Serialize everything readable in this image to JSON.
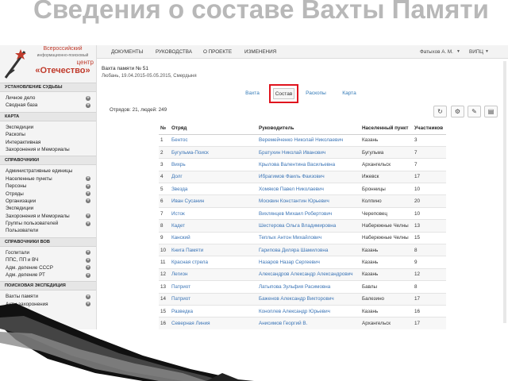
{
  "slide_title": "Сведения о составе Вахты Памяти",
  "logo": {
    "line1": "Всероссийский",
    "line2": "информационно-поисковый",
    "line3": "центр",
    "line4": "«Отечество»"
  },
  "sidebar": {
    "sections": [
      {
        "title": "УСТАНОВЛЕНИЕ СУДЬБЫ",
        "items": [
          {
            "label": "Личное дело",
            "plus": true
          },
          {
            "label": "Сводная база",
            "plus": true
          }
        ]
      },
      {
        "title": "КАРТА",
        "items": [
          {
            "label": "Экспедиции",
            "plus": false
          },
          {
            "label": "Раскопы",
            "plus": false
          },
          {
            "label": "Интерактивная",
            "plus": false
          },
          {
            "label": "Захоронения и Мемориалы",
            "plus": false
          }
        ]
      },
      {
        "title": "СПРАВОЧНИКИ",
        "items": [
          {
            "label": "Административные единицы",
            "plus": false
          },
          {
            "label": "Населенные пункты",
            "plus": true
          },
          {
            "label": "Персоны",
            "plus": true
          },
          {
            "label": "Отряды",
            "plus": true
          },
          {
            "label": "Организации",
            "plus": true
          },
          {
            "label": "Экспедиции",
            "plus": false
          },
          {
            "label": "Захоронения и Мемориалы",
            "plus": true
          },
          {
            "label": "Группы пользователей",
            "plus": true
          },
          {
            "label": "Пользователи",
            "plus": false
          }
        ]
      },
      {
        "title": "СПРАВОЧНИКИ ВОВ",
        "items": [
          {
            "label": "Госпитали",
            "plus": true
          },
          {
            "label": "ППС, ПП и ВЧ",
            "plus": true
          },
          {
            "label": "Адм. деление СССР",
            "plus": true
          },
          {
            "label": "Адм. деление РТ",
            "plus": true
          }
        ]
      },
      {
        "title": "ПОИСКОВАЯ ЭКСПЕДИЦИЯ",
        "items": [
          {
            "label": "Вахты памяти",
            "plus": true
          },
          {
            "label": "Акты захоронения",
            "plus": true
          }
        ]
      }
    ]
  },
  "topnav": {
    "items": [
      "ДОКУМЕНТЫ",
      "РУКОВОДСТВА",
      "О ПРОЕКТЕ",
      "ИЗМЕНЕНИЯ"
    ],
    "user": "Фатыхов А. М.",
    "org": "ВИПЦ"
  },
  "watch": {
    "title": "Вахта памяти № 51",
    "subtitle": "Любань, 19.04.2015-05.05.2015, Смердыня"
  },
  "tabs": [
    "Вахта",
    "Состав",
    "Раскопы",
    "Карта"
  ],
  "stats": "Отрядов: 21, людей: 249",
  "toolbar_icons": [
    "refresh-icon",
    "gear-icon",
    "edit-icon",
    "print-icon"
  ],
  "table": {
    "columns": [
      "№",
      "Отряд",
      "Руководитель",
      "Населенный пункт",
      "Участников"
    ],
    "rows": [
      [
        "1",
        "Бентос",
        "Веремейченко Николай Николаевич",
        "Казань",
        "3"
      ],
      [
        "2",
        "Бугульма-Поиск",
        "Братухин Николай Иванович",
        "Бугульма",
        "7"
      ],
      [
        "3",
        "Вихрь",
        "Крылова Валентина Васильевна",
        "Архангельск",
        "7"
      ],
      [
        "4",
        "Долг",
        "Ибрагимов Фаиль Фаизович",
        "Ижевск",
        "17"
      ],
      [
        "5",
        "Звезда",
        "Хомяков Павел Николаевич",
        "Бронницы",
        "10"
      ],
      [
        "6",
        "Иван Сусанин",
        "Москвин Константин Юрьевич",
        "Колпино",
        "20"
      ],
      [
        "7",
        "Исток",
        "Вихлянцев Михаил Робертович",
        "Череповец",
        "10"
      ],
      [
        "8",
        "Кадет",
        "Шестерова Ольга Владимировна",
        "Набережные Челны",
        "13"
      ],
      [
        "9",
        "Канский",
        "Теплых Антон Михайлович",
        "Набережные Челны",
        "15"
      ],
      [
        "10",
        "Книга Памяти",
        "Гарипова Диляра Шамиловна",
        "Казань",
        "8"
      ],
      [
        "11",
        "Красная стрела",
        "Назаров Назар Сергеевич",
        "Казань",
        "9"
      ],
      [
        "12",
        "Легион",
        "Александров Александр Александрович",
        "Казань",
        "12"
      ],
      [
        "13",
        "Патриот",
        "Латыпова Зульфия Расимовна",
        "Бавлы",
        "8"
      ],
      [
        "14",
        "Патриот",
        "Баженов Александр Викторович",
        "Балезино",
        "17"
      ],
      [
        "15",
        "Разведка",
        "Коноплев Александр Юрьевич",
        "Казань",
        "16"
      ],
      [
        "16",
        "Северная Линия",
        "Анисимов Георгий В.",
        "Архангельск",
        "17"
      ]
    ]
  }
}
